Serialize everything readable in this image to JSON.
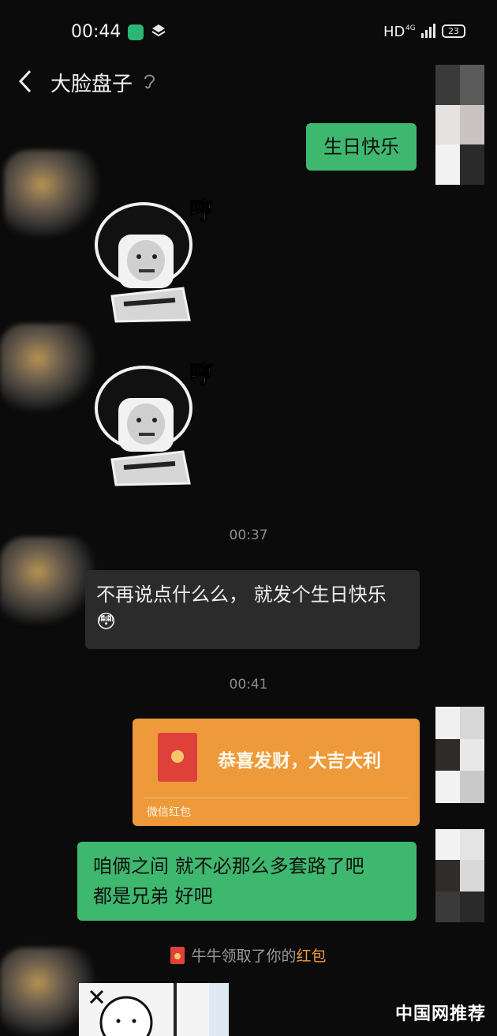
{
  "status_bar": {
    "time": "00:44",
    "network": "HD",
    "signal": "4G",
    "battery": "23"
  },
  "header": {
    "title": "大脸盘子",
    "back_icon": "chevron-left-icon",
    "mute_icon": "ear-icon"
  },
  "messages": {
    "m1_text": "生日快乐",
    "sticker_caption": "哼",
    "time1": "00:37",
    "m2_line1": "不再说点什么么， 就发个生日快乐",
    "m2_emoji": "😳",
    "time2": "00:41",
    "red_packet": {
      "title": "恭喜发财，大吉大利",
      "footer": "微信红包"
    },
    "m3_line1": "咱俩之间 就不必那么多套路了吧",
    "m3_line2": "都是兄弟 好吧"
  },
  "system_note": {
    "prefix": "牛牛领取了你的",
    "link": "红包"
  },
  "watermark": "中国网推荐",
  "colors": {
    "bg": "#0b0b0b",
    "bubble_green": "#3fb86f",
    "bubble_dark": "#2b2b2b",
    "red_packet": "#ee9a3a"
  }
}
